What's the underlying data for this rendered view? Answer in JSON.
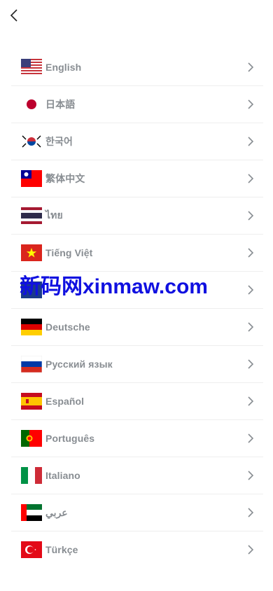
{
  "header": {
    "back_icon": "chevron-left-icon"
  },
  "languages": [
    {
      "label": "English",
      "flag": "flag-us-icon"
    },
    {
      "label": "日本語",
      "flag": "flag-japan-icon"
    },
    {
      "label": "한국어",
      "flag": "flag-korea-icon"
    },
    {
      "label": "繁体中文",
      "flag": "flag-taiwan-icon"
    },
    {
      "label": "ไทย",
      "flag": "flag-thailand-icon"
    },
    {
      "label": "Tiếng Việt",
      "flag": "flag-vietnam-icon"
    },
    {
      "label": "",
      "flag": "flag-icon"
    },
    {
      "label": "Deutsche",
      "flag": "flag-germany-icon"
    },
    {
      "label": "Русский язык",
      "flag": "flag-russia-icon"
    },
    {
      "label": "Español",
      "flag": "flag-spain-icon"
    },
    {
      "label": "Português",
      "flag": "flag-portugal-icon"
    },
    {
      "label": "Italiano",
      "flag": "flag-italy-icon"
    },
    {
      "label": "عربي",
      "flag": "flag-uae-icon"
    },
    {
      "label": "Türkçe",
      "flag": "flag-turkey-icon"
    }
  ],
  "watermark": "新码网xinmaw.com",
  "colors": {
    "label": "#888d92",
    "divider": "#eeeeee",
    "watermark": "#1010e0"
  }
}
